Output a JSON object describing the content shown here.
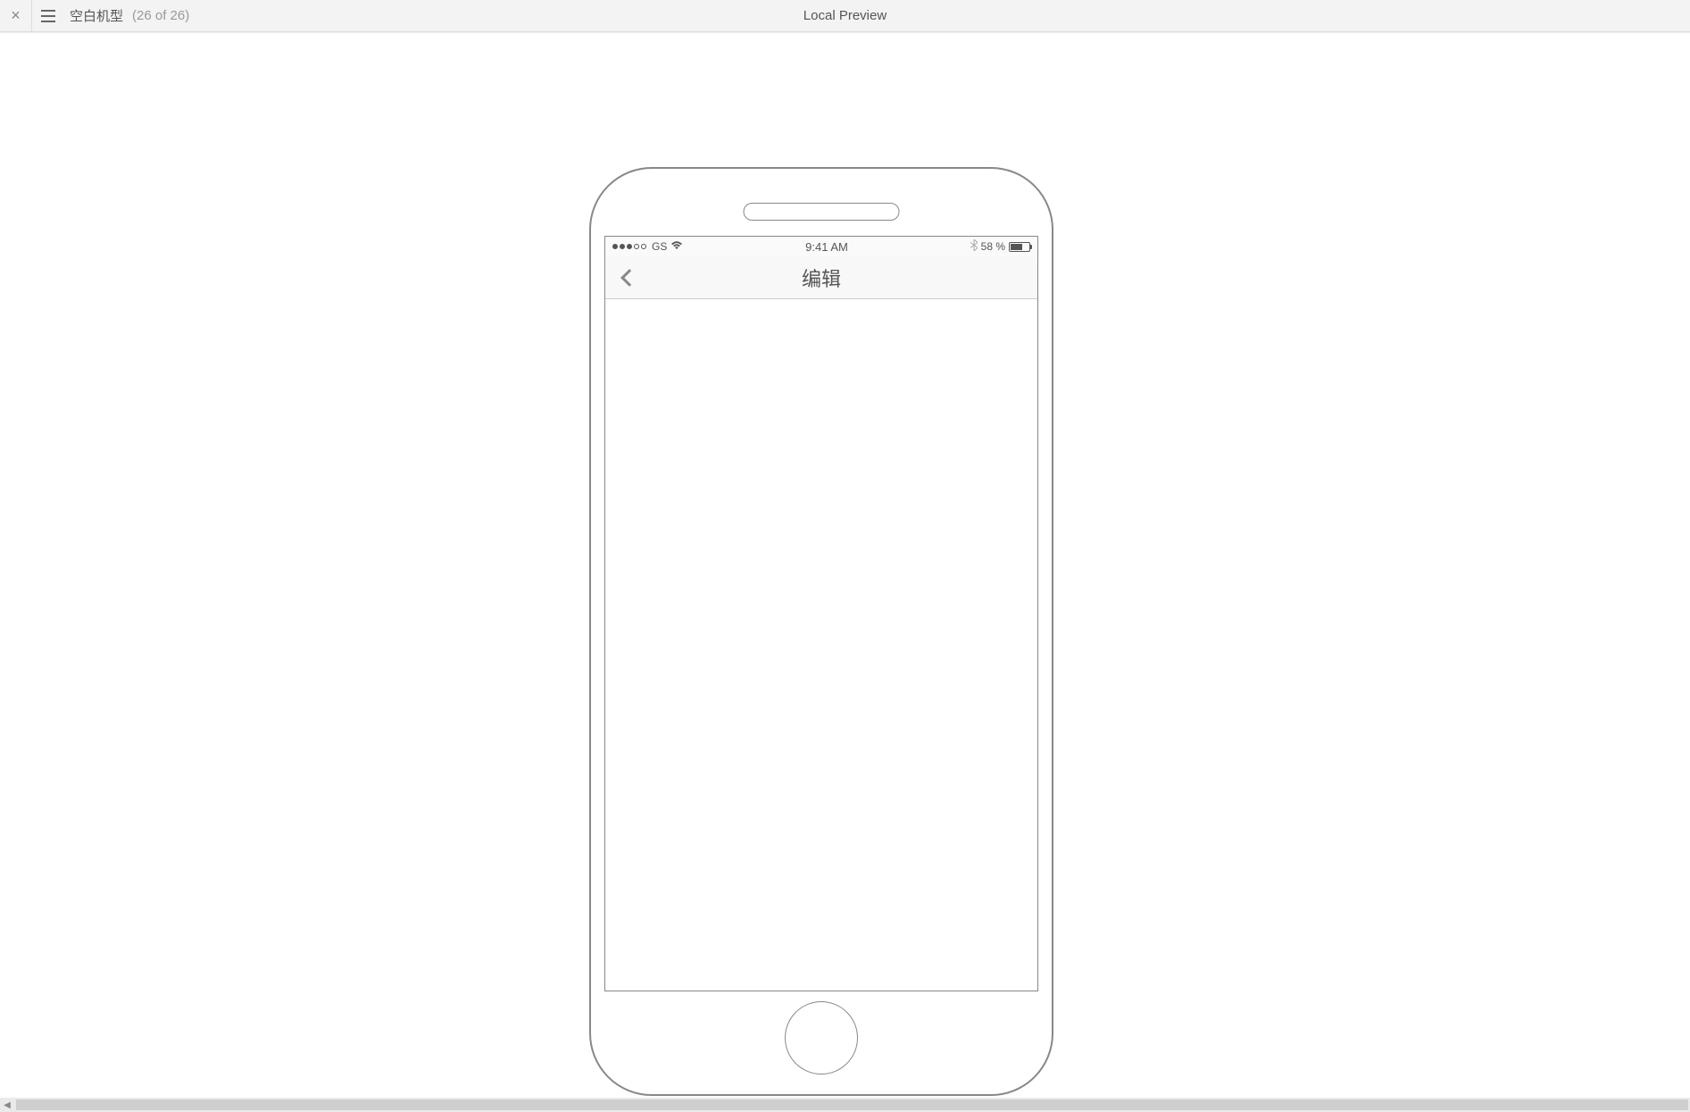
{
  "toolbar": {
    "page_name": "空白机型",
    "page_count": "(26 of 26)",
    "preview_label": "Local Preview"
  },
  "device": {
    "status_bar": {
      "carrier": "GS",
      "time": "9:41 AM",
      "battery_percent": "58 %"
    },
    "nav": {
      "title": "编辑"
    }
  }
}
